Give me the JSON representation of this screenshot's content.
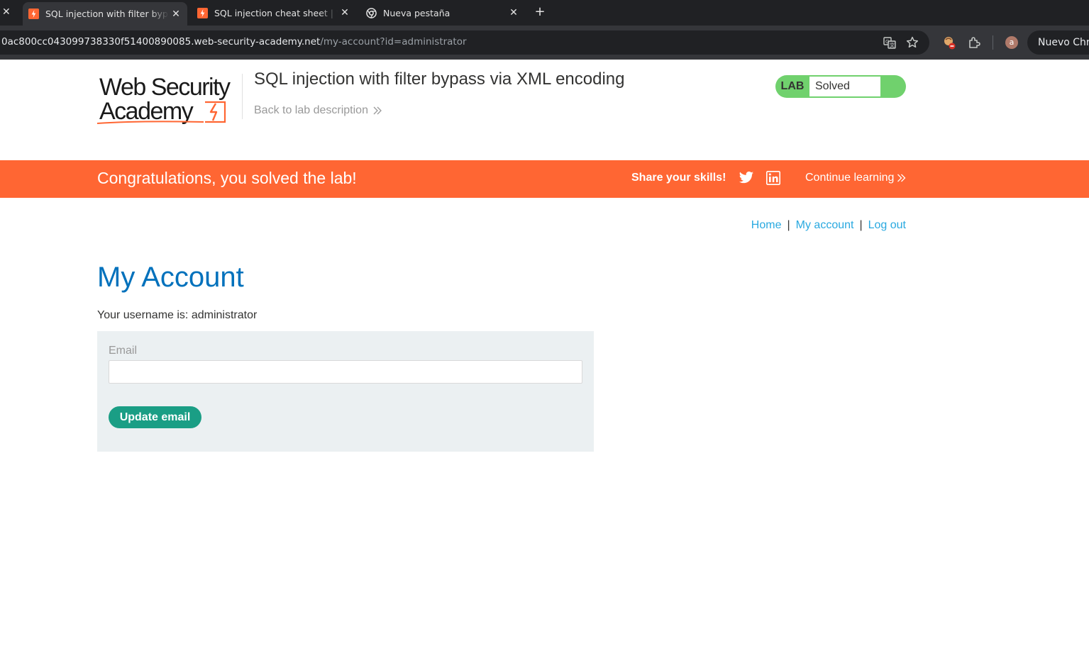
{
  "browser": {
    "tabs": [
      {
        "title": "SQL injection with filter bypass via XML encoding",
        "active": true
      },
      {
        "title": "SQL injection cheat sheet | Web Security Academy",
        "active": false
      },
      {
        "title": "Nueva pestaña",
        "active": false
      }
    ],
    "close_glyph": "✕",
    "new_tab_glyph": "+",
    "url_host": "0ac800cc043099738330f51400890085.web-security-academy.net",
    "url_path": "/my-account?id=administrator",
    "avatar_letter": "a",
    "profile_label": "Nuevo Chrome"
  },
  "header": {
    "logo_line1": "Web Security",
    "logo_line2": "Academy",
    "lab_title": "SQL injection with filter bypass via XML encoding",
    "back_link": "Back to lab description",
    "lab_label": "LAB",
    "lab_status": "Solved"
  },
  "banner": {
    "message": "Congratulations, you solved the lab!",
    "share": "Share your skills!",
    "continue": "Continue learning"
  },
  "nav": {
    "home": "Home",
    "separator": "|",
    "my_account": "My account",
    "log_out": "Log out"
  },
  "main": {
    "heading": "My Account",
    "username_text": "Your username is: administrator",
    "email_label": "Email",
    "email_value": "",
    "update_button": "Update email"
  },
  "colors": {
    "accent_orange": "#ff6633",
    "link_blue": "#29a9e0",
    "heading_blue": "#0071bc",
    "solved_green": "#70d16d",
    "button_teal": "#1a9e85"
  }
}
